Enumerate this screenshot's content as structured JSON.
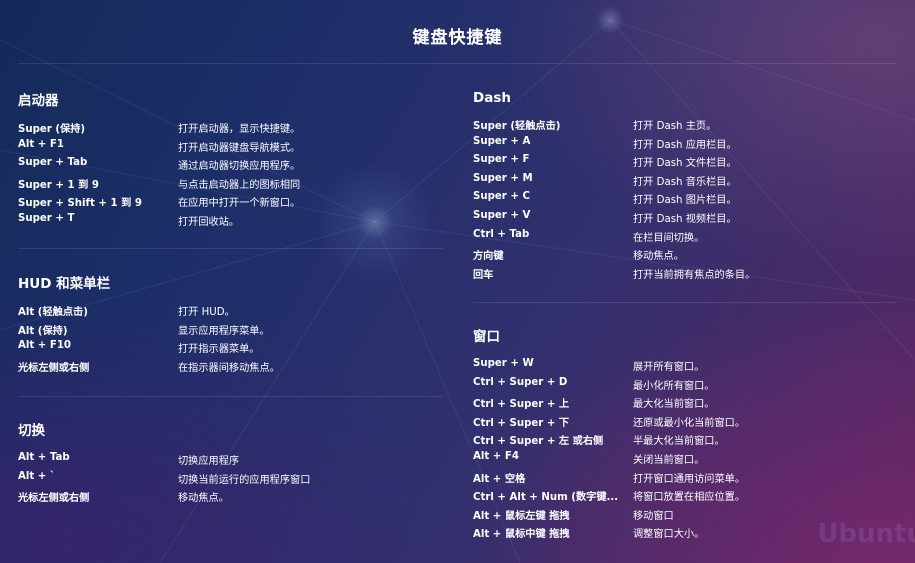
{
  "title": "键盘快捷键",
  "watermark": "Ubuntu",
  "left_sections": [
    {
      "title": "启动器",
      "rows": [
        {
          "key": "Super (保持)",
          "desc": "打开启动器，显示快捷键。"
        },
        {
          "key": "Alt + F1",
          "desc": "打开启动器键盘导航模式。"
        },
        {
          "key": "Super + Tab",
          "desc": "通过启动器切换应用程序。"
        },
        {
          "key": "Super + 1 到 9",
          "desc": "与点击启动器上的图标相同"
        },
        {
          "key": "Super + Shift + 1 到 9",
          "desc": "在应用中打开一个新窗口。"
        },
        {
          "key": "Super + T",
          "desc": "打开回收站。"
        }
      ]
    },
    {
      "title": "HUD 和菜单栏",
      "rows": [
        {
          "key": "Alt (轻触点击)",
          "desc": "打开 HUD。"
        },
        {
          "key": "Alt (保持)",
          "desc": "显示应用程序菜单。"
        },
        {
          "key": "Alt + F10",
          "desc": "打开指示器菜单。"
        },
        {
          "key": "光标左侧或右侧",
          "desc": "在指示器间移动焦点。"
        }
      ]
    },
    {
      "title": "切换",
      "rows": [
        {
          "key": "Alt + Tab",
          "desc": "切换应用程序"
        },
        {
          "key": "Alt + `",
          "desc": "切换当前运行的应用程序窗口"
        },
        {
          "key": "光标左侧或右侧",
          "desc": "移动焦点。"
        }
      ]
    }
  ],
  "right_sections": [
    {
      "title": "Dash",
      "rows": [
        {
          "key": "Super (轻触点击)",
          "desc": "打开 Dash 主页。"
        },
        {
          "key": "Super + A",
          "desc": "打开 Dash 应用栏目。"
        },
        {
          "key": "Super + F",
          "desc": "打开 Dash 文件栏目。"
        },
        {
          "key": "Super + M",
          "desc": "打开 Dash 音乐栏目。"
        },
        {
          "key": "Super + C",
          "desc": "打开 Dash 图片栏目。"
        },
        {
          "key": "Super + V",
          "desc": "打开 Dash 视频栏目。"
        },
        {
          "key": "Ctrl + Tab",
          "desc": "在栏目间切换。"
        },
        {
          "key": "方向键",
          "desc": "移动焦点。"
        },
        {
          "key": "回车",
          "desc": "打开当前拥有焦点的条目。"
        }
      ]
    },
    {
      "title": "窗口",
      "rows": [
        {
          "key": "Super + W",
          "desc": "展开所有窗口。"
        },
        {
          "key": "Ctrl + Super + D",
          "desc": "最小化所有窗口。"
        },
        {
          "key": "Ctrl + Super + 上",
          "desc": "最大化当前窗口。"
        },
        {
          "key": "Ctrl + Super + 下",
          "desc": "还原或最小化当前窗口。"
        },
        {
          "key": "Ctrl + Super + 左 或右侧",
          "desc": "半最大化当前窗口。"
        },
        {
          "key": "Alt + F4",
          "desc": "关闭当前窗口。"
        },
        {
          "key": "Alt + 空格",
          "desc": "打开窗口通用访问菜单。"
        },
        {
          "key": "Ctrl + Alt + Num (数字键...",
          "desc": "将窗口放置在相应位置。"
        },
        {
          "key": "Alt + 鼠标左键 拖拽",
          "desc": "移动窗口"
        },
        {
          "key": "Alt + 鼠标中键 拖拽",
          "desc": "调整窗口大小。"
        }
      ]
    }
  ]
}
